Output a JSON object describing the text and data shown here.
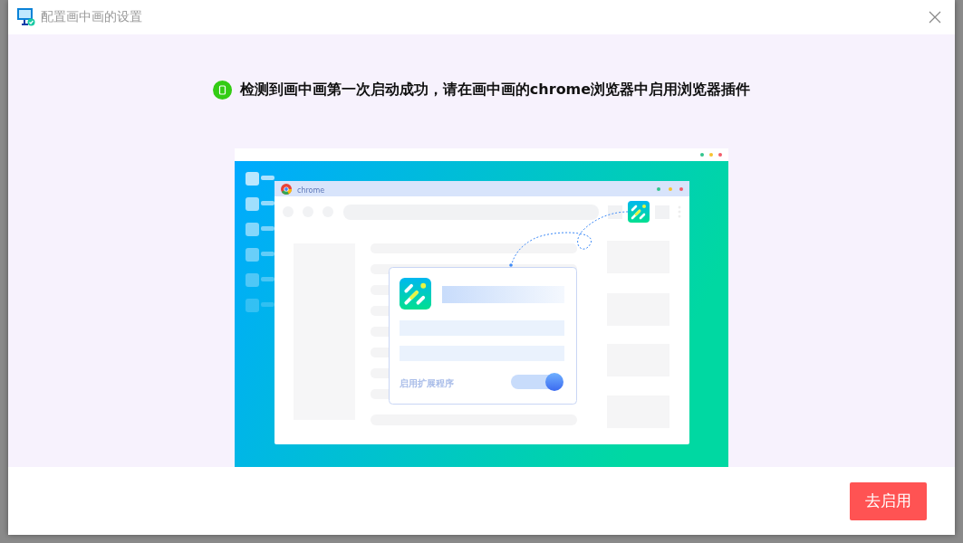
{
  "window": {
    "title": "配置画中画的设置"
  },
  "message": "检测到画中画第一次启动成功，请在画中画的chrome浏览器中启用浏览器插件",
  "illustration": {
    "browser_label": "chrome",
    "popup_label": "启用扩展程序",
    "toggle_on": true
  },
  "button": "去启用"
}
